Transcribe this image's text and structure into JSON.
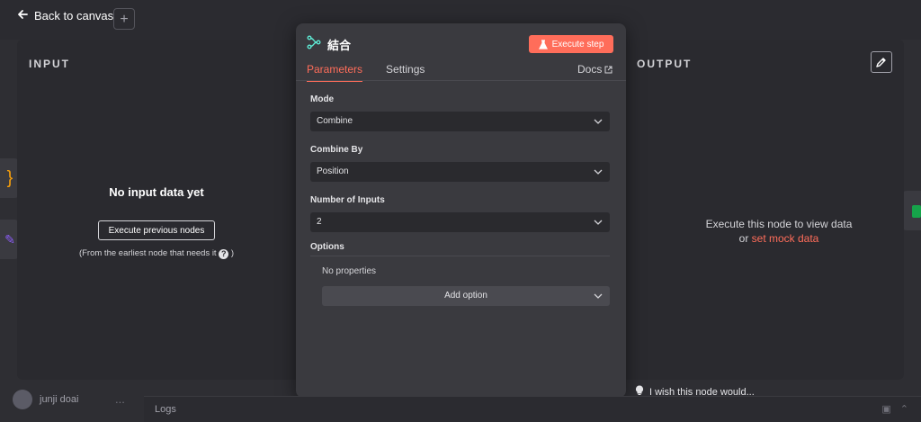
{
  "topbar": {
    "back_label": "Back to canvas",
    "plus_label": "+"
  },
  "input_panel": {
    "title": "INPUT",
    "empty_title": "No input data yet",
    "execute_previous_label": "Execute previous nodes",
    "hint": "(From the earliest node that needs it",
    "hint_close": ")",
    "help_glyph": "?"
  },
  "output_panel": {
    "title": "OUTPUT",
    "message_line1": "Execute this node to view data",
    "message_or": "or",
    "mock_link": "set mock data"
  },
  "node": {
    "title": "結合",
    "execute_step_label": "Execute step",
    "tabs": [
      "Parameters",
      "Settings"
    ],
    "active_tab": "Parameters",
    "docs_label": "Docs",
    "fields": {
      "mode": {
        "label": "Mode",
        "value": "Combine"
      },
      "combine_by": {
        "label": "Combine By",
        "value": "Position"
      },
      "number_of_inputs": {
        "label": "Number of Inputs",
        "value": "2"
      }
    },
    "options": {
      "label": "Options",
      "empty": "No properties",
      "add_label": "Add option"
    }
  },
  "footer": {
    "user_name": "junji doai",
    "user_menu": "...",
    "logs_label": "Logs",
    "wish_label": "I wish this node would..."
  },
  "colors": {
    "accent": "#ff6d5a",
    "background": "#2e2e33",
    "modal": "#3a3a3f"
  },
  "icons": [
    "back-arrow-icon",
    "plus-icon",
    "merge-icon",
    "flask-icon",
    "external-link-icon",
    "chevron-down-icon",
    "pencil-icon",
    "help-icon",
    "lightbulb-icon"
  ]
}
